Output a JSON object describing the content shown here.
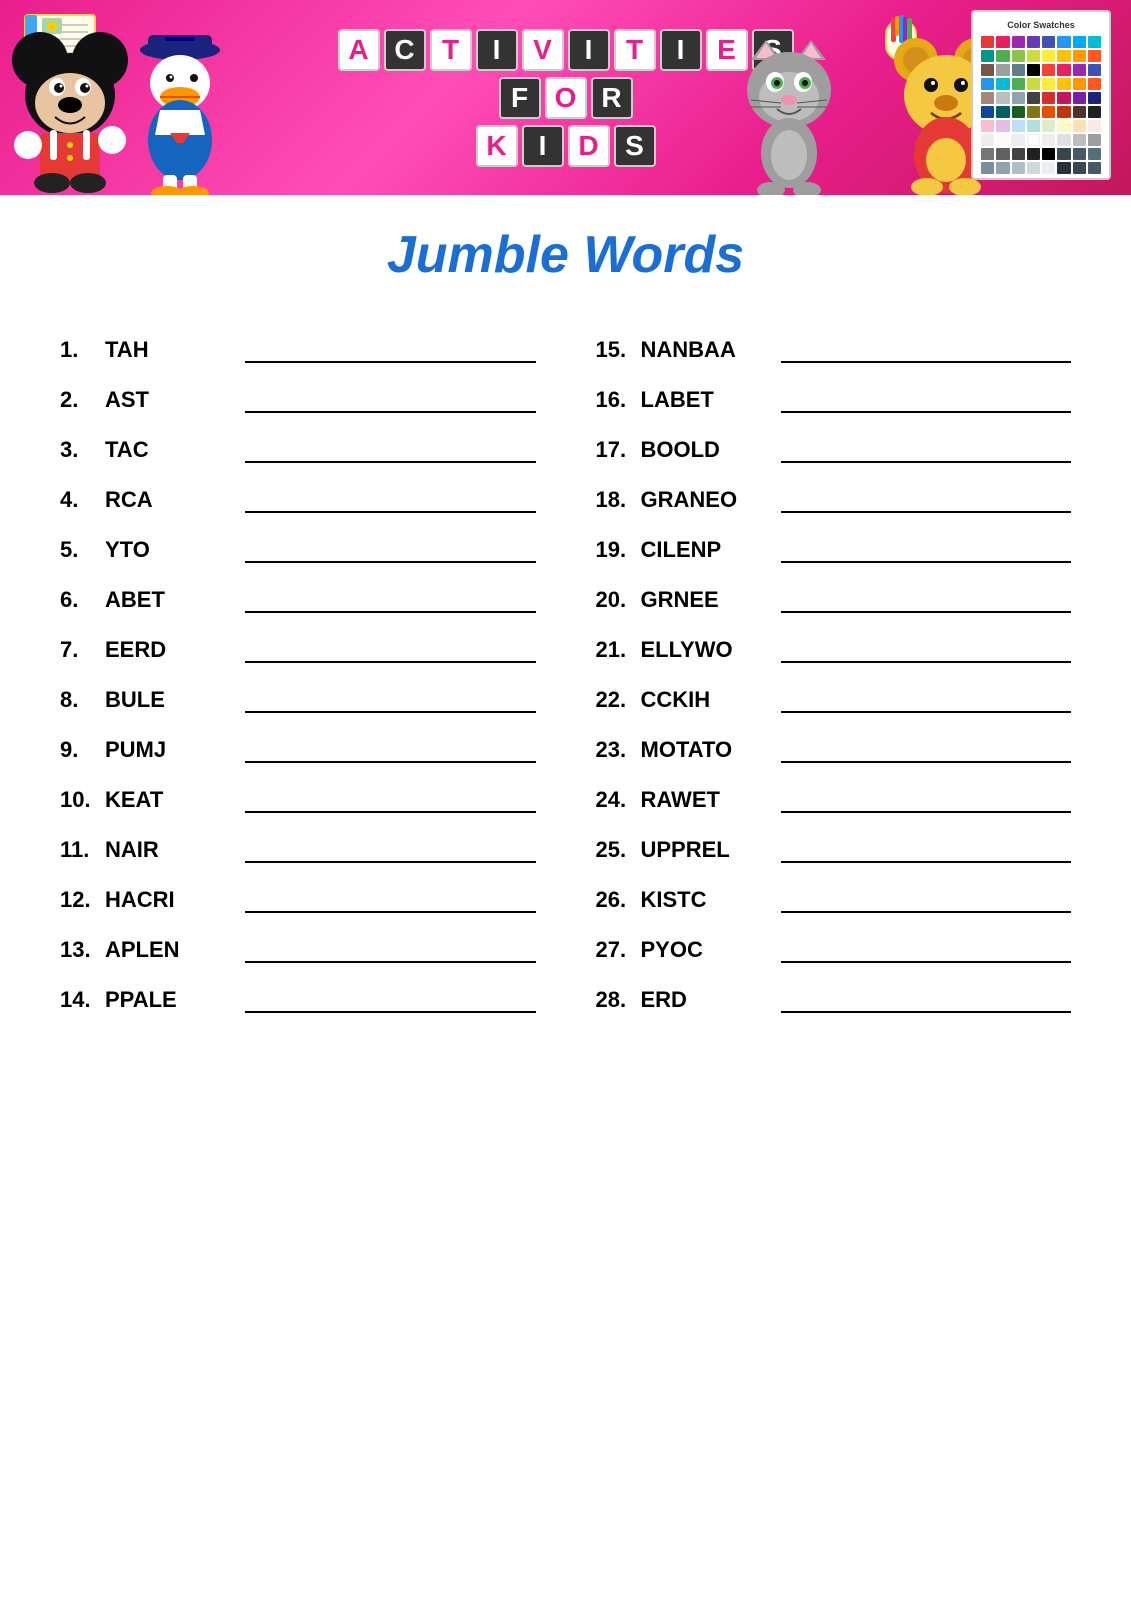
{
  "header": {
    "title": "Activities For Kids",
    "activities_letters": [
      "A",
      "C",
      "T",
      "I",
      "V",
      "I",
      "T",
      "I",
      "E",
      "S"
    ],
    "for_letters": [
      "F",
      "O",
      "R"
    ],
    "kids_letters": [
      "K",
      "I",
      "D",
      "S"
    ]
  },
  "page": {
    "title": "Jumble Words"
  },
  "palette_colors": [
    [
      "#e53935",
      "#e91e63",
      "#9c27b0",
      "#673ab7",
      "#3f51b5",
      "#2196f3",
      "#03a9f4",
      "#00bcd4"
    ],
    [
      "#009688",
      "#4caf50",
      "#8bc34a",
      "#cddc39",
      "#ffeb3b",
      "#ffc107",
      "#ff9800",
      "#ff5722"
    ],
    [
      "#795548",
      "#9e9e9e",
      "#607d8b",
      "#000000",
      "#f44336",
      "#e91e63",
      "#9c27b0",
      "#3f51b5"
    ],
    [
      "#2196f3",
      "#00bcd4",
      "#4caf50",
      "#cddc39",
      "#ffeb3b",
      "#ffc107",
      "#ff9800",
      "#ff5722"
    ],
    [
      "#a1887f",
      "#bdbdbd",
      "#90a4ae",
      "#424242",
      "#d32f2f",
      "#c2185b",
      "#7b1fa2",
      "#1a237e"
    ],
    [
      "#0d47a1",
      "#006064",
      "#1b5e20",
      "#827717",
      "#e65100",
      "#bf360c",
      "#4e342e",
      "#212121"
    ],
    [
      "#f8bbd0",
      "#e1bee7",
      "#bbdefb",
      "#b2dfdb",
      "#dcedc8",
      "#fff9c4",
      "#ffe0b2",
      "#fbe9e7"
    ],
    [
      "#efebe9",
      "#fafafa",
      "#eceff1",
      "#ffffff",
      "#eeeeee",
      "#f5f5f5",
      "#e0e0e0",
      "#bdbdbd"
    ],
    [
      "#757575",
      "#616161",
      "#424242",
      "#212121",
      "#000000",
      "#37474f",
      "#455a64",
      "#546e7a"
    ],
    [
      "#78909c",
      "#90a4ae",
      "#b0bec5",
      "#cfd8dc",
      "#eceff1",
      "#263238",
      "#37474f",
      "#455a64"
    ],
    [
      "#ff8f00",
      "#f57f17",
      "#558b2f",
      "#33691e",
      "#1b5e20",
      "#006064",
      "#0277bd",
      "#01579b"
    ],
    [
      "#4a148c",
      "#880e4f",
      "#b71c1c",
      "#d50000",
      "#ff1744",
      "#ff4081",
      "#f50057",
      "#e040fb"
    ],
    [
      "#7c4dff",
      "#651fff",
      "#3d5afe",
      "#2979ff",
      "#00b0ff",
      "#00e5ff",
      "#1de9b6",
      "#00e676"
    ]
  ],
  "words_left": [
    {
      "number": "1.",
      "word": "TAH"
    },
    {
      "number": "2.",
      "word": "AST"
    },
    {
      "number": "3.",
      "word": "TAC"
    },
    {
      "number": "4.",
      "word": "RCA"
    },
    {
      "number": "5.",
      "word": "YTO"
    },
    {
      "number": "6.",
      "word": "ABET"
    },
    {
      "number": "7.",
      "word": "EERD"
    },
    {
      "number": "8.",
      "word": "BULE"
    },
    {
      "number": "9.",
      "word": "PUMJ"
    },
    {
      "number": "10.",
      "word": "KEAT"
    },
    {
      "number": "11.",
      "word": "NAIR"
    },
    {
      "number": "12.",
      "word": "HACRI"
    },
    {
      "number": "13.",
      "word": "APLEN"
    },
    {
      "number": "14.",
      "word": "PPALE"
    }
  ],
  "words_right": [
    {
      "number": "15.",
      "word": "NANBAA"
    },
    {
      "number": "16.",
      "word": "LABET"
    },
    {
      "number": "17.",
      "word": "BOOLD"
    },
    {
      "number": "18.",
      "word": "GRANEO"
    },
    {
      "number": "19.",
      "word": "CILENP"
    },
    {
      "number": "20.",
      "word": "GRNEE"
    },
    {
      "number": "21.",
      "word": "ELLYWO"
    },
    {
      "number": "22.",
      "word": "CCKIH"
    },
    {
      "number": "23.",
      "word": "MOTATO"
    },
    {
      "number": "24.",
      "word": "RAWET"
    },
    {
      "number": "25.",
      "word": "UPPREL"
    },
    {
      "number": "26.",
      "word": "KISTC"
    },
    {
      "number": "27.",
      "word": "PYOC"
    },
    {
      "number": "28.",
      "word": "ERD"
    }
  ]
}
